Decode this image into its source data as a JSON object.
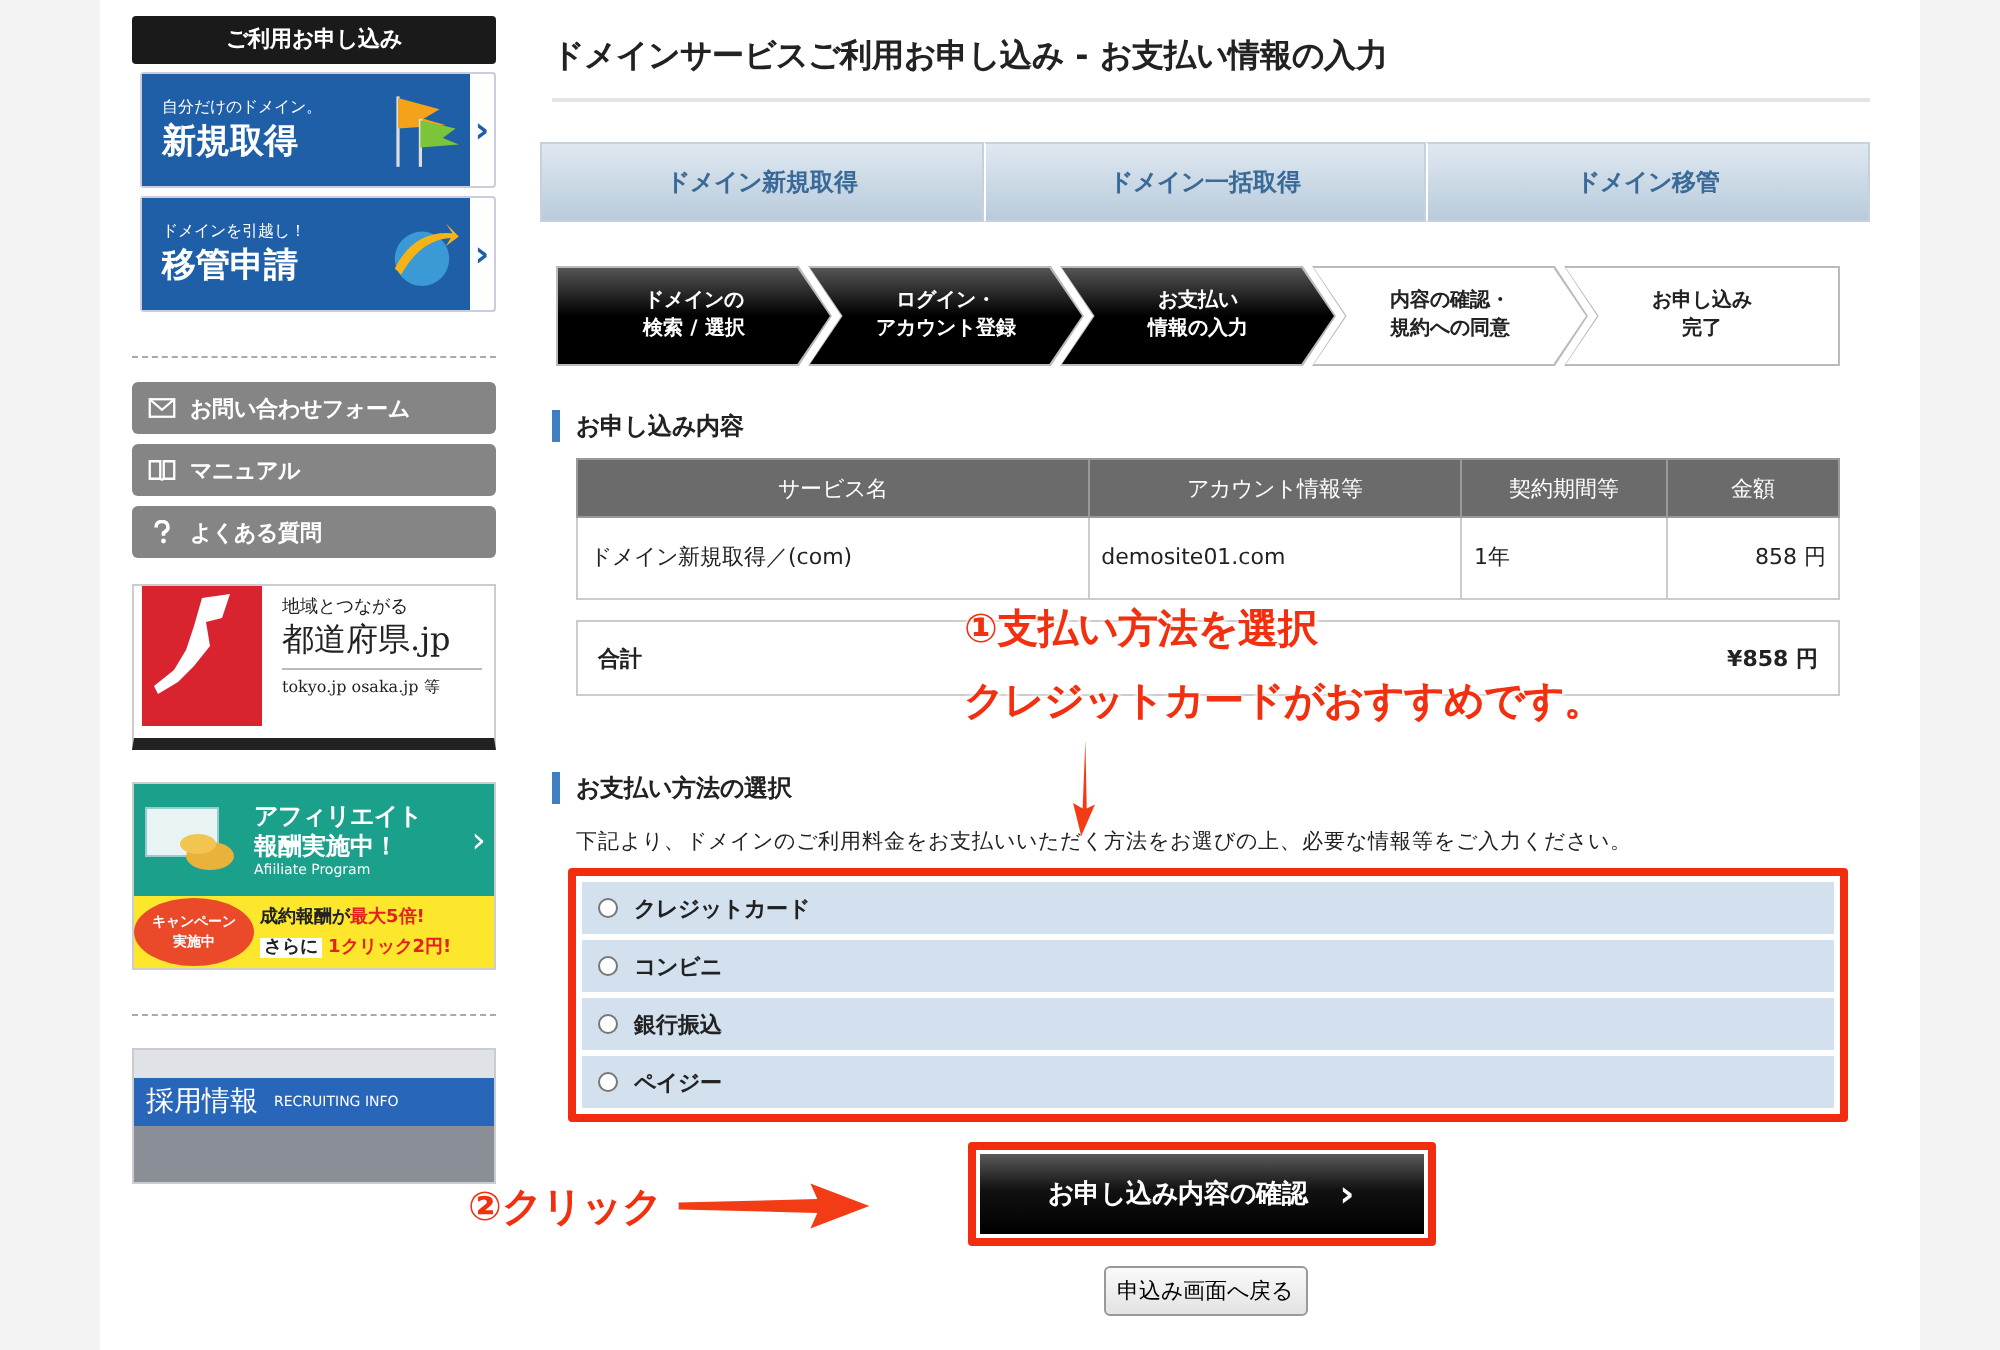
{
  "sidebar": {
    "heading": "ご利用お申し込み",
    "promo_banners": [
      {
        "kind": "flags",
        "tagline": "自分だけのドメイン。",
        "title": "新規取得"
      },
      {
        "kind": "globe",
        "tagline": "ドメインを引越し！",
        "title": "移管申請"
      }
    ],
    "menu": [
      {
        "kind": "mail",
        "label": "お問い合わせフォーム"
      },
      {
        "kind": "book",
        "label": "マニュアル"
      },
      {
        "kind": "question",
        "label": "よくある質問"
      }
    ],
    "prefecture_banner": {
      "tagline": "地域とつながる",
      "title": "都道府県.jp",
      "examples": "tokyo.jp osaka.jp 等"
    },
    "affiliate_banner": {
      "title_1": "アフィリエイト",
      "title_2": "報酬実施中！",
      "subtitle": "Afiiliate Program",
      "badge_1": "キャンペーン",
      "badge_2": "実施中",
      "line_1a": "成約報酬が",
      "line_1b": "最大5倍!",
      "line_2a": "さらに",
      "line_2b": "1クリック2円!"
    },
    "recruit_banner": {
      "title": "採用情報",
      "subtitle": "RECRUITING INFO"
    }
  },
  "page_title": "ドメインサービスご利用お申し込み - お支払い情報の入力",
  "tabs": [
    {
      "label": "ドメイン新規取得"
    },
    {
      "label": "ドメイン一括取得"
    },
    {
      "label": "ドメイン移管"
    }
  ],
  "steps": [
    {
      "line_1": "ドメインの",
      "line_2": "検索 / 選択",
      "completed": true
    },
    {
      "line_1": "ログイン・",
      "line_2": "アカウント登録",
      "completed": true
    },
    {
      "line_1": "お支払い",
      "line_2": "情報の入力",
      "completed": true
    },
    {
      "line_1": "内容の確認・",
      "line_2": "規約への同意",
      "completed": false
    },
    {
      "line_1": "お申し込み",
      "line_2": "完了",
      "completed": false
    }
  ],
  "order_section": {
    "heading": "お申し込み内容",
    "table": {
      "columns": [
        "サービス名",
        "アカウント情報等",
        "契約期間等",
        "金額"
      ],
      "rows": [
        [
          "ドメイン新規取得／(com)",
          "demosite01.com",
          "1年",
          "858 円"
        ]
      ]
    },
    "total": {
      "label": "合計",
      "amount": "¥858 円"
    }
  },
  "payment_section": {
    "heading": "お支払い方法の選択",
    "description": "下記より、ドメインのご利用料金をお支払いいただく方法をお選びの上、必要な情報等をご入力ください。",
    "options": [
      {
        "label": "クレジットカード",
        "selected": false
      },
      {
        "label": "コンビニ",
        "selected": false
      },
      {
        "label": "銀行振込",
        "selected": false
      },
      {
        "label": "ペイジー",
        "selected": false
      }
    ]
  },
  "confirm_button": {
    "label": "お申し込み内容の確認",
    "icon": "›"
  },
  "back_button": {
    "label": "申込み画面へ戻る"
  },
  "annotations": [
    {
      "kind": "select",
      "line_1": "①支払い方法を選択",
      "line_2": "クレジットカードがおすすめです。"
    },
    {
      "kind": "click",
      "text": "②クリック"
    }
  ]
}
